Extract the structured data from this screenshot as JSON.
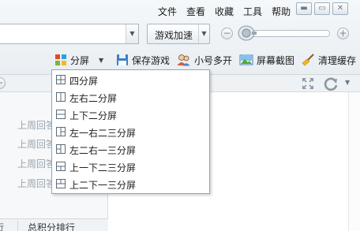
{
  "menu": [
    "文件",
    "查看",
    "收藏",
    "工具",
    "帮助"
  ],
  "window_controls": {
    "restore": "▭",
    "minimize": "▬",
    "close": "✕"
  },
  "address_bar": {
    "value": ""
  },
  "speedup": {
    "label": "游戏加速"
  },
  "volume": {
    "minus": "−",
    "plus": "+"
  },
  "toolbar": {
    "split_screen": "分屏",
    "save_game": "保存游戏",
    "multi_account": "小号多开",
    "screenshot": "屏幕截图",
    "clear_cache": "清理缓存"
  },
  "tab_row": {
    "new_tab": "+"
  },
  "left_list": [
    "上周回答",
    "上周回答",
    "上周回答",
    "上周回答"
  ],
  "bottom_tabs": {
    "partial": "行",
    "rank": "总积分排行"
  },
  "split_menu": {
    "items": [
      {
        "label": "四分屏",
        "layout": "quad"
      },
      {
        "label": "左右二分屏",
        "layout": "lr2"
      },
      {
        "label": "上下二分屏",
        "layout": "tb2"
      },
      {
        "label": "左一右二三分屏",
        "layout": "l1r2"
      },
      {
        "label": "左二右一三分屏",
        "layout": "l2r1"
      },
      {
        "label": "上一下二三分屏",
        "layout": "t1b2"
      },
      {
        "label": "上二下一三分屏",
        "layout": "t2b1"
      }
    ]
  },
  "colors": {
    "accent": "#2f7fd0",
    "menu_border": "#9aa5ae",
    "muted_text": "#9aa4ac"
  }
}
